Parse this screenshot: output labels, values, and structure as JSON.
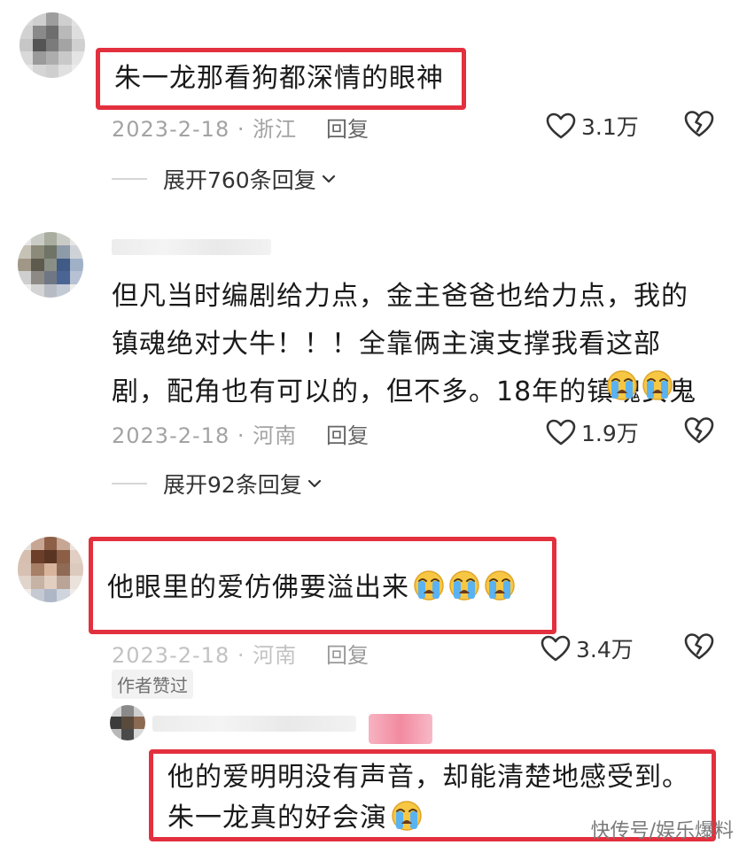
{
  "comments": [
    {
      "text": "朱一龙那看狗都深情的眼神",
      "meta": "2023-2-18 · 浙江",
      "reply_label": "回复",
      "likes": "3.1万",
      "expand_label": "展开760条回复"
    },
    {
      "text": "但凡当时编剧给力点，金主爸爸也给力点，我的镇魂绝对大牛！！！全靠俩主演支撑我看这部剧，配角也有可以的，但不多。18年的镇魂女鬼",
      "meta": "2023-2-18 · 河南",
      "reply_label": "回复",
      "likes": "1.9万",
      "expand_label": "展开92条回复"
    },
    {
      "text": "他眼里的爱仿佛要溢出来",
      "meta": "2023-2-18 · 河南",
      "reply_label": "回复",
      "likes": "3.4万",
      "badge": "作者赞过"
    }
  ],
  "reply": {
    "text": "他的爱明明没有声音，却能清楚地感受到。朱一龙真的好会演"
  },
  "watermark": "快传号/娱乐爆料",
  "icons": {
    "like": "heart-outline-icon",
    "dislike": "broken-heart-icon",
    "emoji": "loudly-crying-face-icon",
    "chevron": "chevron-down-icon"
  },
  "colors": {
    "highlight_border": "#e3303e",
    "meta_text": "#a3a3a3"
  }
}
